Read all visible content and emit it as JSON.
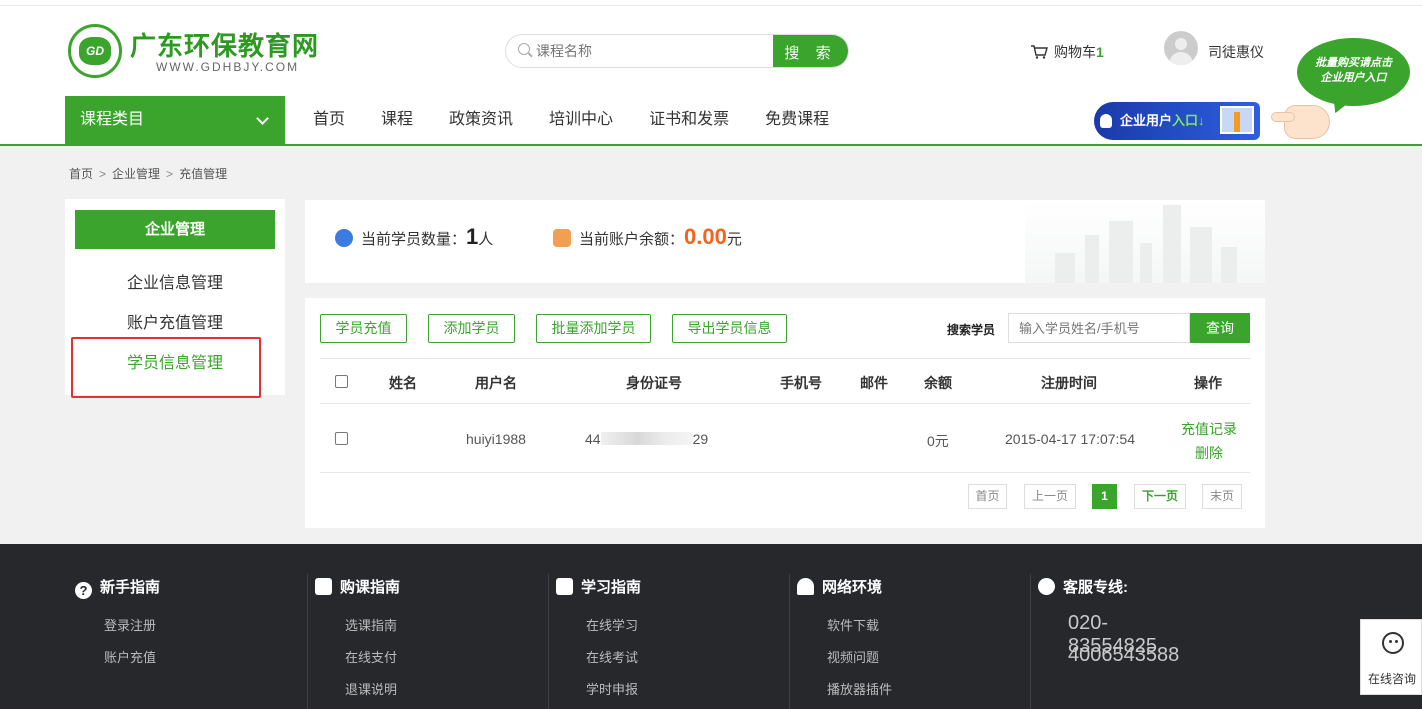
{
  "header": {
    "logo_title": "广东环保教育网",
    "logo_sub": "WWW.GDHBJY.COM",
    "logo_mark": "GD",
    "search_placeholder": "课程名称",
    "search_button": "搜 索",
    "cart_label": "购物车",
    "cart_count": "1",
    "username": "司徒惠仪",
    "bubble_line1": "批量购买请点击",
    "bubble_line2": "企业用户入口",
    "enterprise_entry_prefix": "企业用户",
    "enterprise_entry_accent": "入口",
    "enterprise_entry_arrow": "↓"
  },
  "nav": {
    "category_label": "课程类目",
    "items": [
      "首页",
      "课程",
      "政策资讯",
      "培训中心",
      "证书和发票",
      "免费课程"
    ]
  },
  "breadcrumb": [
    "首页",
    "企业管理",
    "充值管理"
  ],
  "breadcrumb_sep": ">",
  "sidebar": {
    "title": "企业管理",
    "items": [
      "企业信息管理",
      "账户充值管理",
      "学员信息管理"
    ],
    "active_index": 2
  },
  "stats": {
    "students_label": "当前学员数量：",
    "students_value": "1",
    "students_unit": "人",
    "balance_label": "当前账户余额：",
    "balance_value": "0.00",
    "balance_unit": "元"
  },
  "actions": {
    "recharge": "学员充值",
    "add": "添加学员",
    "batch_add": "批量添加学员",
    "export": "导出学员信息",
    "search_label": "搜索学员",
    "search_placeholder": "输入学员姓名/手机号",
    "query": "查询"
  },
  "table": {
    "headers": [
      "姓名",
      "用户名",
      "身份证号",
      "手机号",
      "邮件",
      "余额",
      "注册时间",
      "操作"
    ],
    "rows": [
      {
        "name": "",
        "username": "huiyi1988",
        "id_prefix": "44",
        "id_suffix": "29",
        "phone": "",
        "email": "",
        "balance": "0元",
        "registered": "2015-04-17 17:07:54",
        "op_records": "充值记录",
        "op_delete": "删除"
      }
    ]
  },
  "pagination": {
    "first": "首页",
    "prev": "上一页",
    "current": "1",
    "next": "下一页",
    "last": "末页"
  },
  "footer": {
    "columns": [
      {
        "title": "新手指南",
        "icon": "question-icon",
        "links": [
          "登录注册",
          "账户充值"
        ]
      },
      {
        "title": "购课指南",
        "icon": "cart-guide-icon",
        "links": [
          "选课指南",
          "在线支付",
          "退课说明"
        ]
      },
      {
        "title": "学习指南",
        "icon": "book-icon",
        "links": [
          "在线学习",
          "在线考试",
          "学时申报"
        ]
      },
      {
        "title": "网络环境",
        "icon": "network-icon",
        "links": [
          "软件下载",
          "视频问题",
          "播放器插件"
        ]
      }
    ],
    "service_title": "客服专线:",
    "phones": [
      "020-83554825",
      "4006543588"
    ]
  },
  "consult_label": "在线咨询",
  "colors": {
    "accent": "#3aa42c",
    "balance": "#f5621d",
    "footer_bg": "#26282c",
    "highlight_box": "#e53030"
  }
}
